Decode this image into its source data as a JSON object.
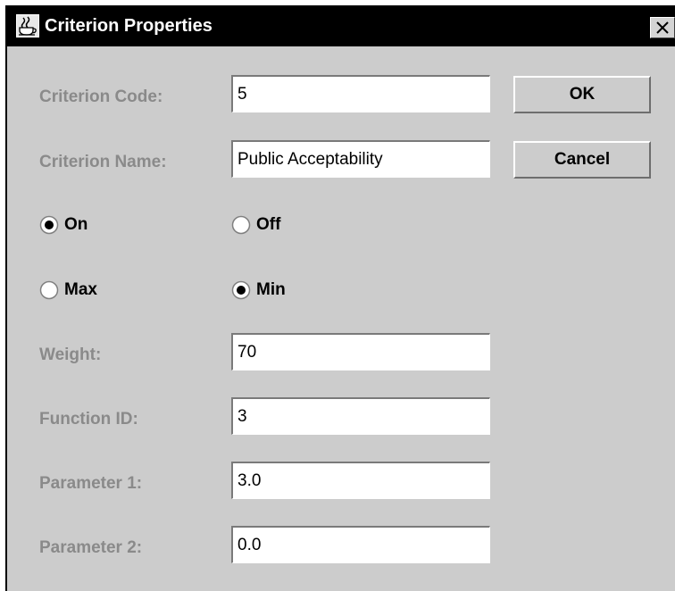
{
  "window": {
    "title": "Criterion Properties",
    "close_glyph": "✕"
  },
  "fields": {
    "code": {
      "label": "Criterion Code:",
      "value": "5"
    },
    "name": {
      "label": "Criterion Name:",
      "value": "Public Acceptability"
    },
    "weight": {
      "label": "Weight:",
      "value": "70"
    },
    "function_id": {
      "label": "Function ID:",
      "value": "3"
    },
    "param1": {
      "label": "Parameter 1:",
      "value": "3.0"
    },
    "param2": {
      "label": "Parameter 2:",
      "value": "0.0"
    }
  },
  "buttons": {
    "ok": "OK",
    "cancel": "Cancel"
  },
  "status_group": {
    "on": {
      "label": "On",
      "selected": true
    },
    "off": {
      "label": "Off",
      "selected": false
    }
  },
  "direction_group": {
    "max": {
      "label": "Max",
      "selected": false
    },
    "min": {
      "label": "Min",
      "selected": true
    }
  },
  "icons": {
    "app": "java-coffee-cup-icon",
    "close": "close-icon",
    "radio": "radio-button-icon"
  },
  "colors": {
    "titlebar": "#000000",
    "dialog_bg": "#cccccc",
    "label_text": "#8a8a8a",
    "field_bg": "#ffffff"
  }
}
